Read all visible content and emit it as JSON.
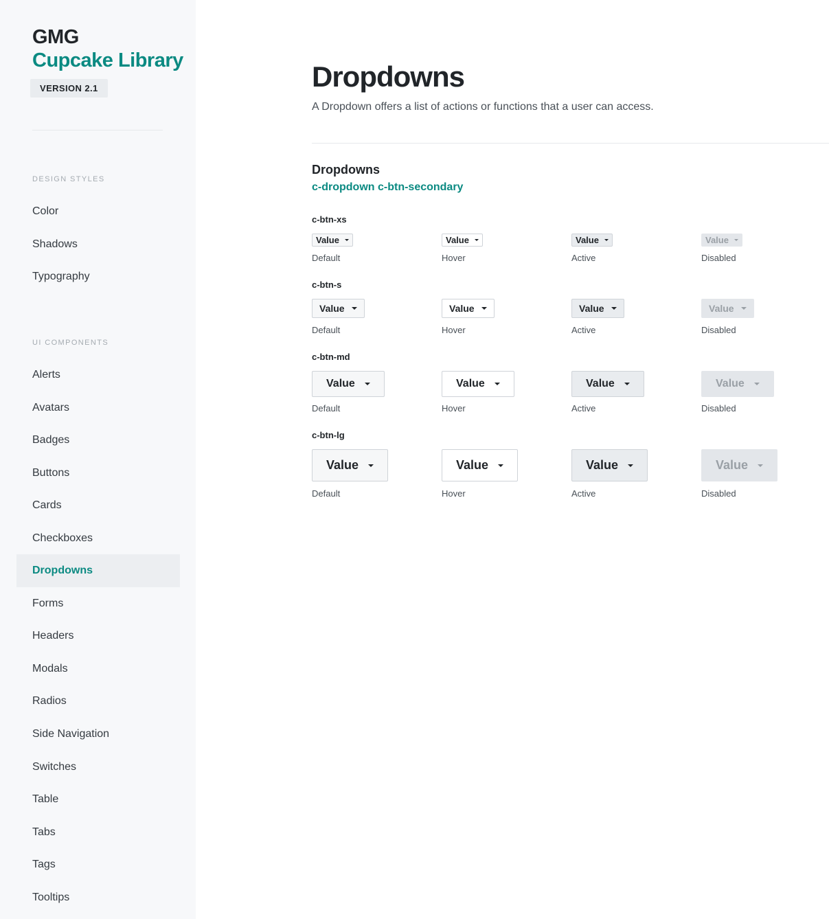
{
  "sidebar": {
    "brand_line1": "GMG",
    "brand_line2": "Cupcake Library",
    "version": "VERSION 2.1",
    "section1_heading": "DESIGN STYLES",
    "section1_items": [
      "Color",
      "Shadows",
      "Typography"
    ],
    "section2_heading": "UI COMPONENTS",
    "section2_items": [
      "Alerts",
      "Avatars",
      "Badges",
      "Buttons",
      "Cards",
      "Checkboxes",
      "Dropdowns",
      "Forms",
      "Headers",
      "Modals",
      "Radios",
      "Side Navigation",
      "Switches",
      "Table",
      "Tabs",
      "Tags",
      "Tooltips"
    ],
    "active_item": "Dropdowns"
  },
  "main": {
    "title": "Dropdowns",
    "description": "A Dropdown offers a list of actions or functions that a user can access.",
    "section_title": "Dropdowns",
    "section_class": "c-dropdown c-btn-secondary",
    "dropdown_value": "Value",
    "states": [
      "Default",
      "Hover",
      "Active",
      "Disabled"
    ],
    "sizes": [
      {
        "label": "c-btn-xs"
      },
      {
        "label": "c-btn-s"
      },
      {
        "label": "c-btn-md"
      },
      {
        "label": "c-btn-lg"
      }
    ]
  },
  "colors": {
    "accent": "#0b8a82",
    "sidebar_bg": "#f7f8fa",
    "text": "#212529"
  },
  "icons": {
    "caret": "caret-down-icon"
  }
}
